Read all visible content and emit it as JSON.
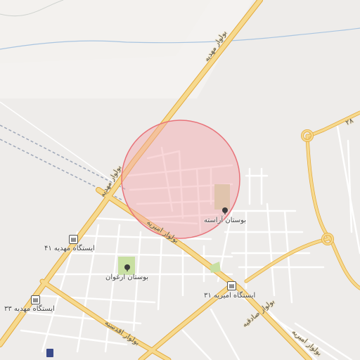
{
  "map": {
    "area_overlay_color": "#f2a7aa",
    "road_color": "#f4c95d",
    "road_casing_color": "#e3a93b",
    "park_color": "#c8dfa2",
    "labels": {
      "mahdieh_blvd_lower": "بولوار مهدیه",
      "mahdieh_blvd_upper": "بولوار مهدیه",
      "amirieh_blvd": "بولوار امیریه",
      "aqdasieh_blvd": "بولوار اقدسیه",
      "sadeghieh_blvd": "بولوار صادقیه",
      "amirieh_blvd_lower": "بولوار امیریه",
      "road_28": "۲۸",
      "park_arasteh": "بوستان آراسته",
      "park_arghavan": "بوستان ارغوان",
      "station_mahdieh_41": "ایستگاه مهدیه ۴۱",
      "station_mahdieh_33": "ایستگاه مهدیه ۳۳",
      "station_amirieh_31": "ایستگاه امیریه ۳۱"
    },
    "icons": {
      "bus": "bus-stop-icon",
      "tree": "park-tree-icon",
      "poi": "poi-icon"
    }
  }
}
